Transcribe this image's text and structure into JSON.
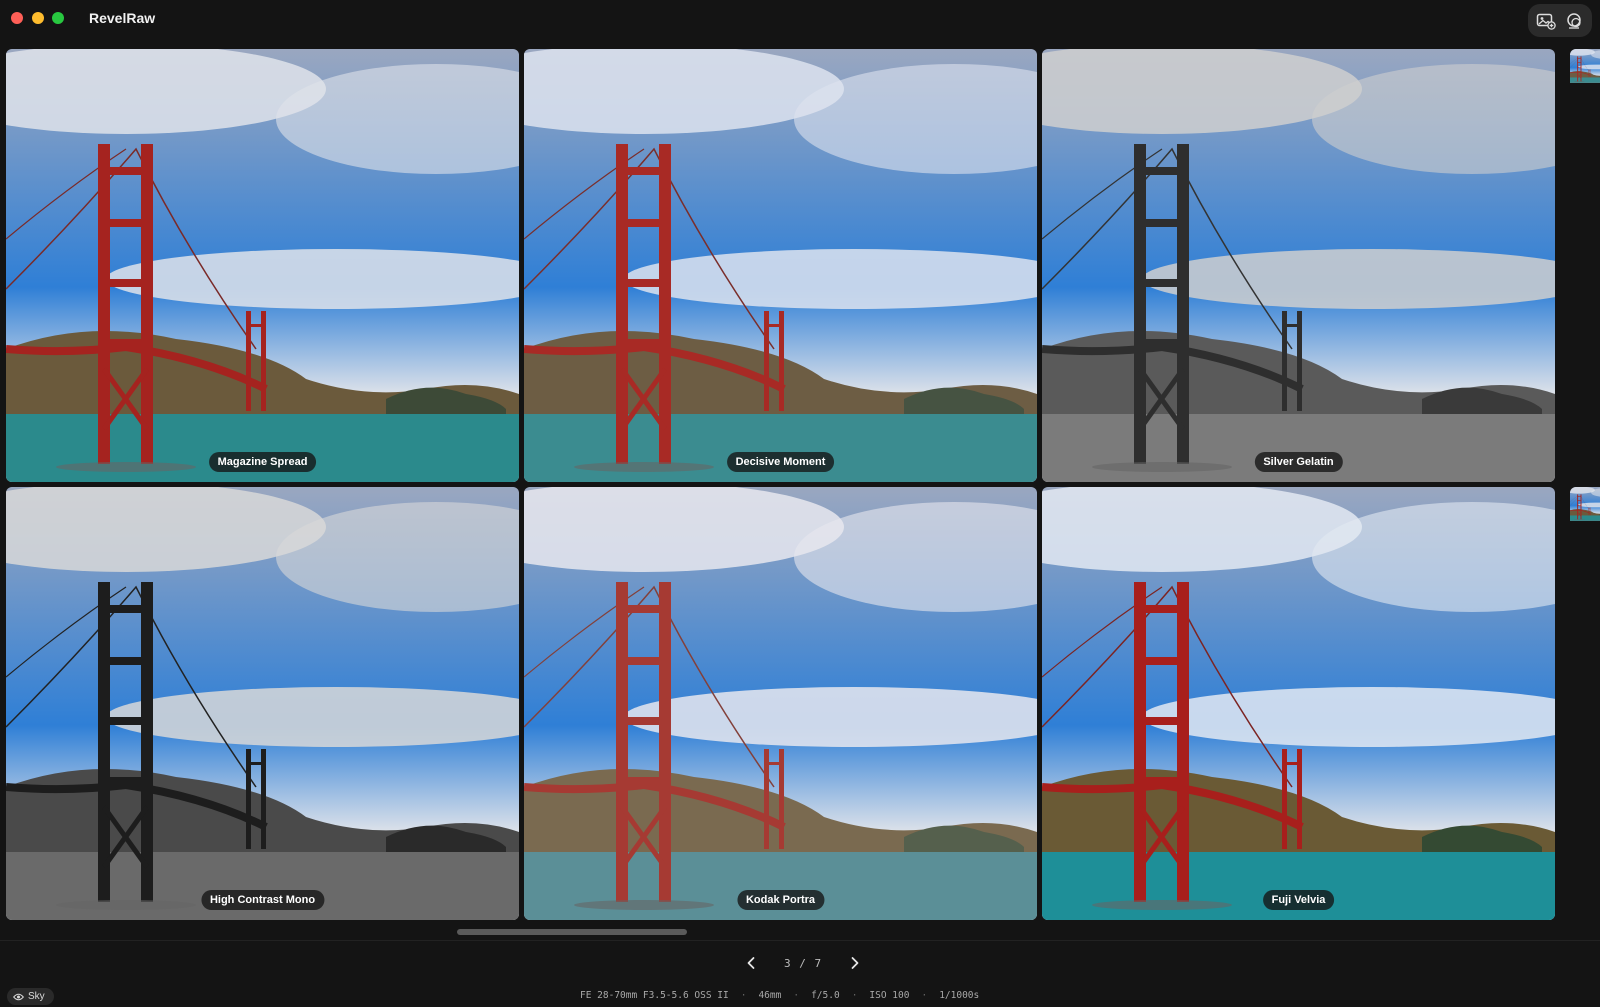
{
  "app": {
    "title": "RevelRaw"
  },
  "toolbar": {
    "icons": [
      "photo-add-icon",
      "compare-icon"
    ]
  },
  "presets": [
    {
      "name": "Magazine Spread",
      "style": "vivid"
    },
    {
      "name": "Decisive Moment",
      "style": "cool"
    },
    {
      "name": "Silver Gelatin",
      "style": "mono"
    },
    {
      "name": "High Contrast Mono",
      "style": "mono-dark"
    },
    {
      "name": "Kodak Portra",
      "style": "soft"
    },
    {
      "name": "Fuji Velvia",
      "style": "saturated"
    }
  ],
  "pager": {
    "current": "3",
    "sep": "/",
    "total": "7",
    "text": "3 / 7"
  },
  "mask_chip": {
    "icon": "eye-icon",
    "label": "Sky"
  },
  "exif": {
    "lens": "FE 28-70mm F3.5-5.6 OSS II",
    "focal": "46mm",
    "aperture": "f/5.0",
    "iso": "ISO 100",
    "shutter": "1/1000s",
    "separator": "·"
  }
}
